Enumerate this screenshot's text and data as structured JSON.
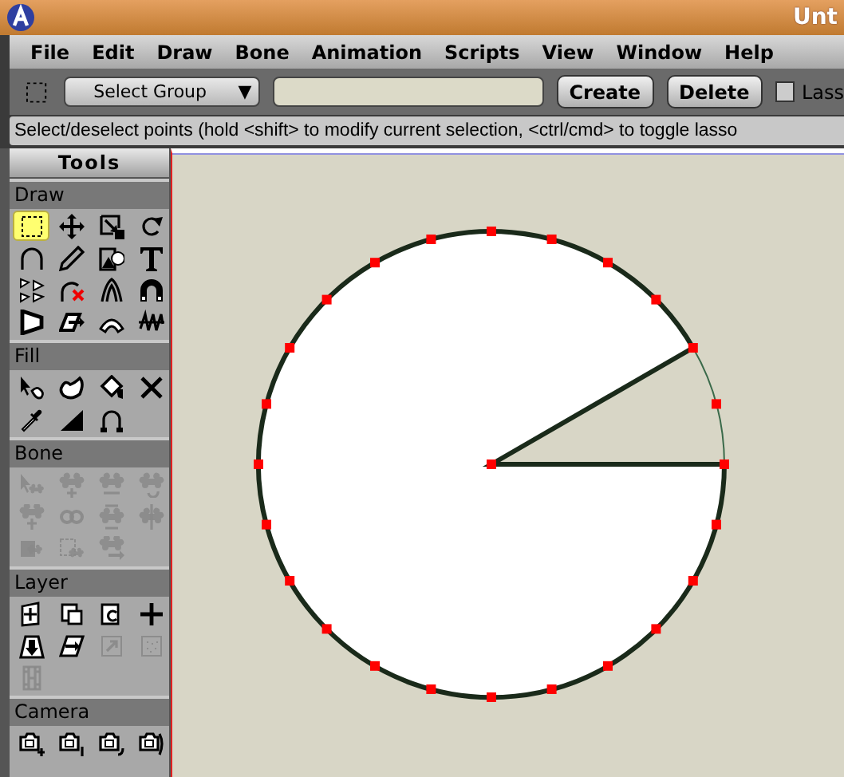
{
  "window": {
    "title": "Unt"
  },
  "menu": [
    "File",
    "Edit",
    "Draw",
    "Bone",
    "Animation",
    "Scripts",
    "View",
    "Window",
    "Help"
  ],
  "toolbar": {
    "group_dropdown": "Select Group",
    "dropdown_arrow": "▼",
    "buttons": [
      "Create",
      "Delete"
    ],
    "lasso": {
      "label": "Lass",
      "checked": false
    }
  },
  "status": "Select/deselect points (hold <shift> to modify current selection, <ctrl/cmd> to toggle lasso",
  "tools": {
    "title": "Tools",
    "groups": [
      {
        "title": "Draw",
        "tools": [
          {
            "selected": true,
            "disabled": false
          },
          {
            "selected": false,
            "disabled": false
          },
          {
            "selected": false,
            "disabled": false
          },
          {
            "selected": false,
            "disabled": false
          },
          {
            "selected": false,
            "disabled": false
          },
          {
            "selected": false,
            "disabled": false
          },
          {
            "selected": false,
            "disabled": false
          },
          {
            "selected": false,
            "disabled": false
          },
          {
            "selected": false,
            "disabled": false
          },
          {
            "selected": false,
            "disabled": false
          },
          {
            "selected": false,
            "disabled": false
          },
          {
            "selected": false,
            "disabled": false
          },
          {
            "selected": false,
            "disabled": false
          },
          {
            "selected": false,
            "disabled": false
          },
          {
            "selected": false,
            "disabled": false
          },
          {
            "selected": false,
            "disabled": false
          }
        ]
      },
      {
        "title": "Fill",
        "tools": [
          {
            "selected": false,
            "disabled": false
          },
          {
            "selected": false,
            "disabled": false
          },
          {
            "selected": false,
            "disabled": false
          },
          {
            "selected": false,
            "disabled": false
          },
          {
            "selected": false,
            "disabled": false
          },
          {
            "selected": false,
            "disabled": false
          },
          {
            "selected": false,
            "disabled": false
          }
        ]
      },
      {
        "title": "Bone",
        "tools": [
          {
            "selected": false,
            "disabled": true
          },
          {
            "selected": false,
            "disabled": true
          },
          {
            "selected": false,
            "disabled": true
          },
          {
            "selected": false,
            "disabled": true
          },
          {
            "selected": false,
            "disabled": true
          },
          {
            "selected": false,
            "disabled": true
          },
          {
            "selected": false,
            "disabled": true
          },
          {
            "selected": false,
            "disabled": true
          },
          {
            "selected": false,
            "disabled": true
          },
          {
            "selected": false,
            "disabled": true
          },
          {
            "selected": false,
            "disabled": true
          }
        ]
      },
      {
        "title": "Layer",
        "tools": [
          {
            "selected": false,
            "disabled": false
          },
          {
            "selected": false,
            "disabled": false
          },
          {
            "selected": false,
            "disabled": false
          },
          {
            "selected": false,
            "disabled": false
          },
          {
            "selected": false,
            "disabled": false
          },
          {
            "selected": false,
            "disabled": false
          },
          {
            "selected": false,
            "disabled": true
          },
          {
            "selected": false,
            "disabled": true
          },
          {
            "selected": false,
            "disabled": true
          }
        ]
      },
      {
        "title": "Camera",
        "tools": [
          {
            "selected": false,
            "disabled": false
          },
          {
            "selected": false,
            "disabled": false
          },
          {
            "selected": false,
            "disabled": false
          },
          {
            "selected": false,
            "disabled": false
          }
        ]
      }
    ]
  }
}
